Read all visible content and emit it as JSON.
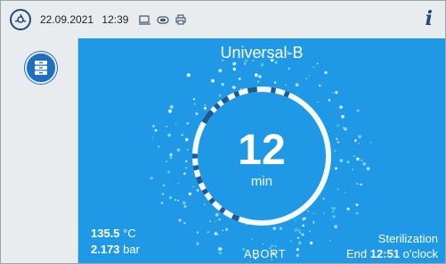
{
  "header": {
    "date": "22.09.2021",
    "time": "12:39",
    "info_icon_label": "i",
    "status_icons": [
      "monitor-icon",
      "network-icon",
      "printer-icon"
    ]
  },
  "sidebar": {
    "menu_icon": "drawers-icon"
  },
  "program": {
    "name": "Universal-B",
    "remaining_value": "12",
    "remaining_unit": "min"
  },
  "readings": {
    "temperature_value": "135.5",
    "temperature_unit": "°C",
    "pressure_value": "2.173",
    "pressure_unit": "bar"
  },
  "actions": {
    "abort_label": "ABORT"
  },
  "phase": {
    "name": "Sterilization",
    "end_prefix": "End",
    "end_time": "12:51",
    "end_suffix": "o'clock"
  },
  "colors": {
    "main_background": "#1f98e6",
    "brand_dark": "#1d4c7c",
    "ring_light": "#ffffff",
    "ring_dark": "#1b5a94"
  }
}
